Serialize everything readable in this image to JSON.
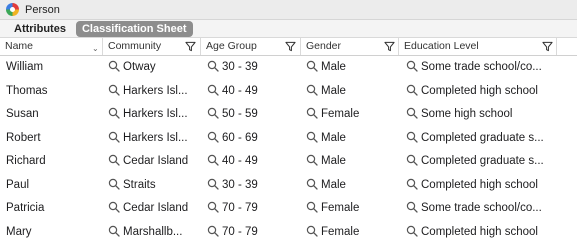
{
  "window": {
    "title": "Person"
  },
  "tabs": [
    {
      "label": "Attributes",
      "active": false
    },
    {
      "label": "Classification Sheet",
      "active": true
    }
  ],
  "columns": [
    {
      "label": "Name",
      "sortable": true,
      "filter": false
    },
    {
      "label": "Community",
      "sortable": false,
      "filter": true
    },
    {
      "label": "Age Group",
      "sortable": false,
      "filter": true
    },
    {
      "label": "Gender",
      "sortable": false,
      "filter": true
    },
    {
      "label": "Education Level",
      "sortable": false,
      "filter": true
    }
  ],
  "rows": [
    {
      "name": "William",
      "community": "Otway",
      "age": "30 - 39",
      "gender": "Male",
      "education": "Some trade school/co..."
    },
    {
      "name": "Thomas",
      "community": "Harkers Isl...",
      "age": "40 - 49",
      "gender": "Male",
      "education": "Completed high school"
    },
    {
      "name": "Susan",
      "community": "Harkers Isl...",
      "age": "50 - 59",
      "gender": "Female",
      "education": "Some high school"
    },
    {
      "name": "Robert",
      "community": "Harkers Isl...",
      "age": "60 - 69",
      "gender": "Male",
      "education": "Completed graduate s..."
    },
    {
      "name": "Richard",
      "community": "Cedar Island",
      "age": "40 - 49",
      "gender": "Male",
      "education": "Completed graduate s..."
    },
    {
      "name": "Paul",
      "community": "Straits",
      "age": "30 - 39",
      "gender": "Male",
      "education": "Completed high school"
    },
    {
      "name": "Patricia",
      "community": "Cedar Island",
      "age": "70 - 79",
      "gender": "Female",
      "education": "Some trade school/co..."
    },
    {
      "name": "Mary",
      "community": "Marshallb...",
      "age": "70 - 79",
      "gender": "Female",
      "education": "Completed high school"
    }
  ],
  "icons": {
    "app": "app-icon",
    "filter": "filter-icon",
    "lookup": "magnifier-icon",
    "sort": "chevron-down-icon"
  }
}
